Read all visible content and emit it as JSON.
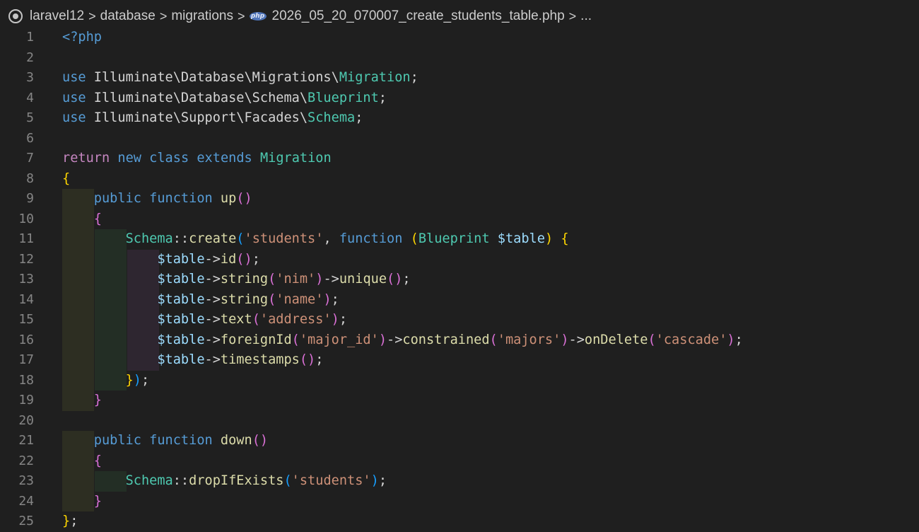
{
  "breadcrumb": {
    "segments": [
      "laravel12",
      "database",
      "migrations",
      "2026_05_20_070007_create_students_table.php",
      "..."
    ],
    "php_icon_text": "php",
    "separator": ">"
  },
  "editor": {
    "line_numbers": [
      "1",
      "2",
      "3",
      "4",
      "5",
      "6",
      "7",
      "8",
      "9",
      "10",
      "11",
      "12",
      "13",
      "14",
      "15",
      "16",
      "17",
      "18",
      "19",
      "20",
      "21",
      "22",
      "23",
      "24",
      "25"
    ],
    "tokens": {
      "open_tag": "<?php",
      "use": "use",
      "ns1": "Illuminate\\Database\\Migrations\\",
      "migration": "Migration",
      "ns2": "Illuminate\\Database\\Schema\\",
      "blueprint": "Blueprint",
      "ns3": "Illuminate\\Support\\Facades\\",
      "schema": "Schema",
      "semi": ";",
      "return": "return",
      "new": "new",
      "class": "class",
      "extends": "extends",
      "public": "public",
      "function": "function",
      "up": "up",
      "down": "down",
      "create": "create",
      "students": "'students'",
      "table_var": "$table",
      "arrow": "->",
      "id": "id",
      "string": "string",
      "nim": "'nim'",
      "unique": "unique",
      "name": "'name'",
      "text": "text",
      "address": "'address'",
      "foreignId": "foreignId",
      "major_id": "'major_id'",
      "constrained": "constrained",
      "majors": "'majors'",
      "onDelete": "onDelete",
      "cascade": "'cascade'",
      "timestamps": "timestamps",
      "dropIfExists": "dropIfExists"
    }
  }
}
